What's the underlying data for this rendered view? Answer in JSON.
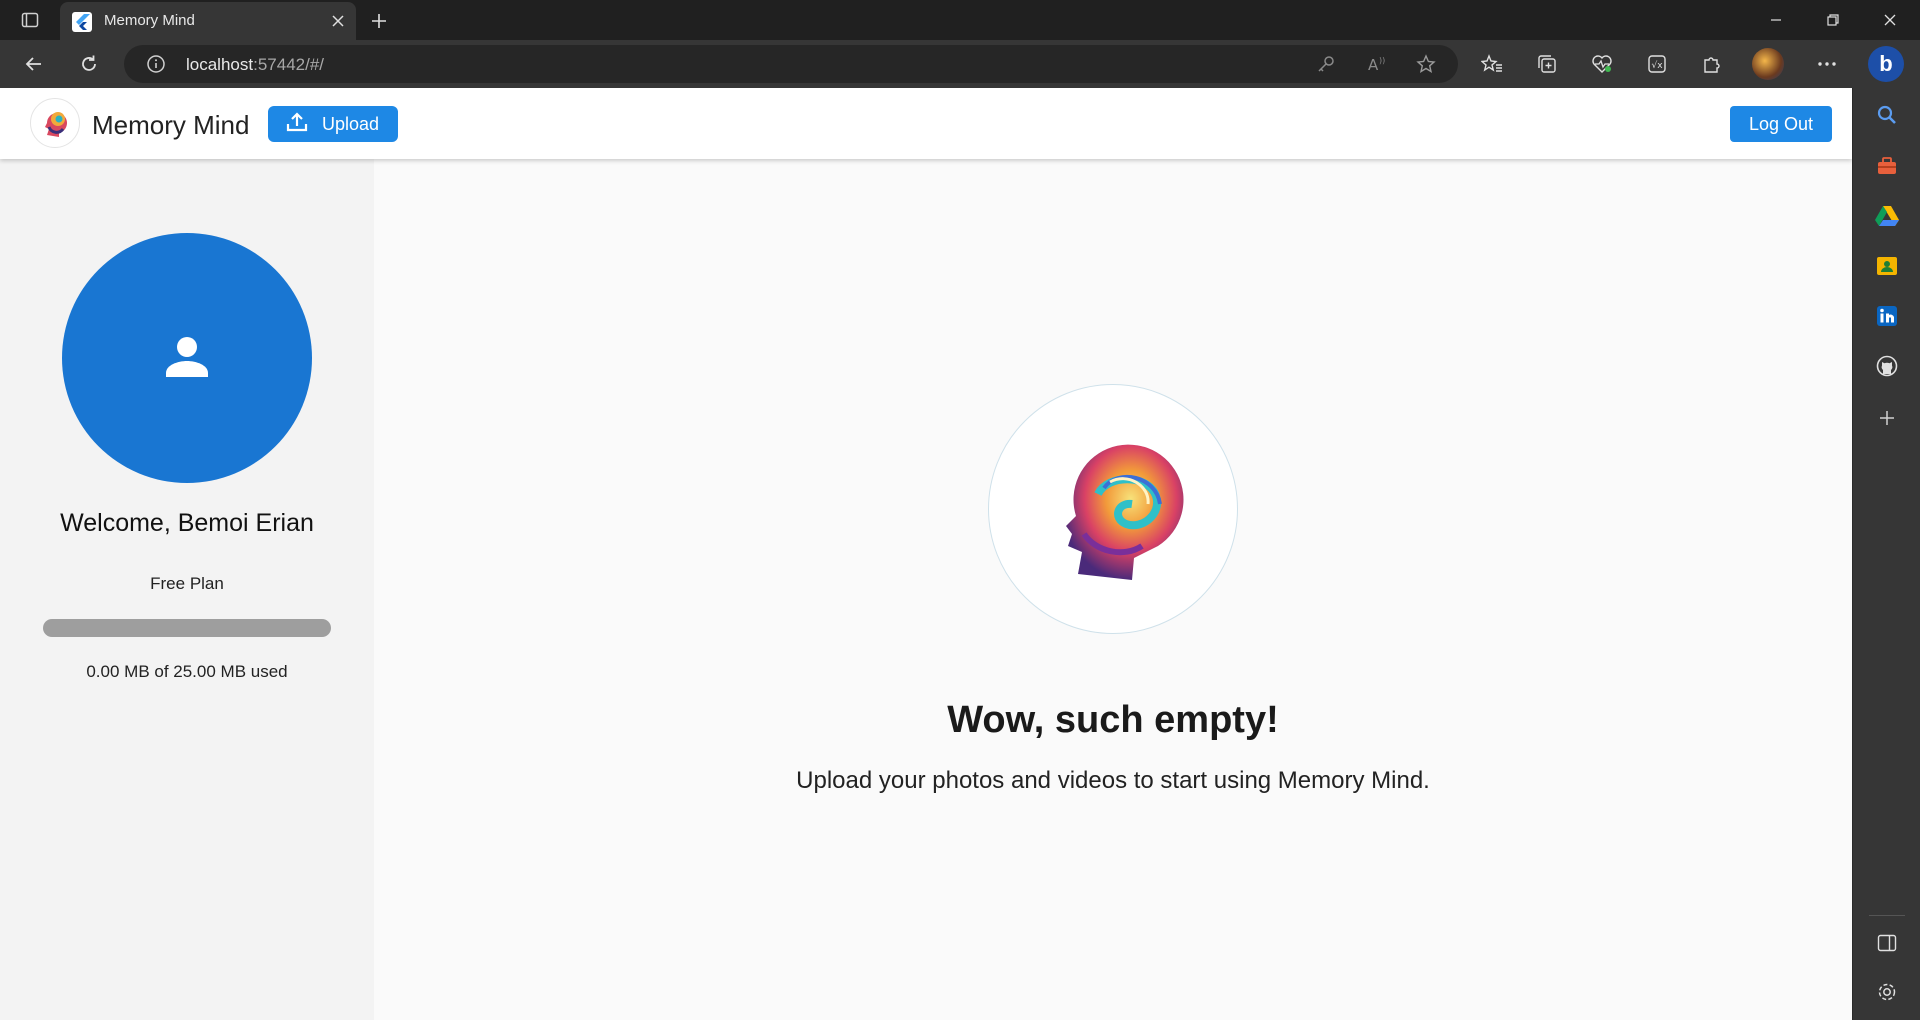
{
  "browser": {
    "tab_title": "Memory Mind",
    "url_host": "localhost",
    "url_rest": ":57442/#/"
  },
  "app": {
    "title": "Memory Mind",
    "upload_label": "Upload",
    "logout_label": "Log Out",
    "accent_color": "#1e88e5"
  },
  "sidebar": {
    "welcome": "Welcome, Bemoi Erian",
    "plan": "Free Plan",
    "usage_text": "0.00 MB of 25.00 MB used",
    "usage_fraction": 0
  },
  "main": {
    "empty_title": "Wow, such empty!",
    "empty_subtitle": "Upload your photos and videos to start using Memory Mind."
  },
  "icons": {
    "edge_sidebar": [
      "search-icon",
      "toolbox-icon",
      "google-drive-icon",
      "contacts-icon",
      "linkedin-icon",
      "github-icon",
      "add-icon",
      "split-screen-icon",
      "settings-icon"
    ]
  }
}
